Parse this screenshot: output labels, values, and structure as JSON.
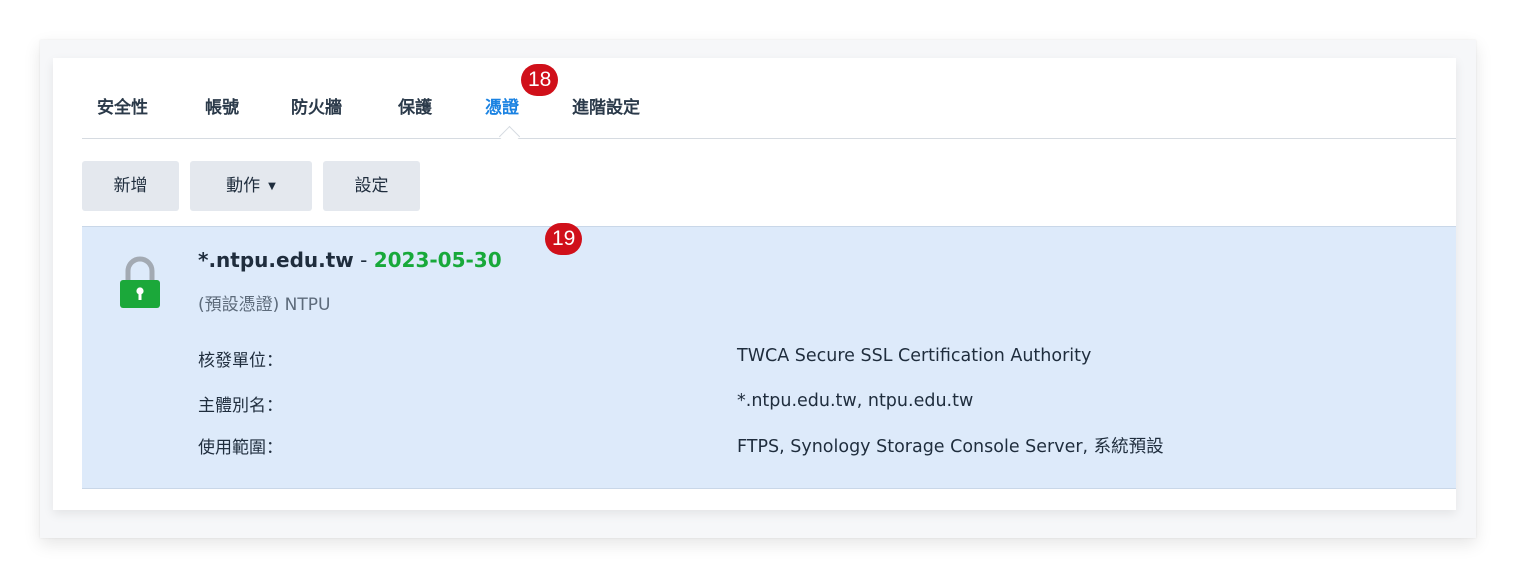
{
  "tabs": [
    {
      "label": "安全性",
      "active": false
    },
    {
      "label": "帳號",
      "active": false
    },
    {
      "label": "防火牆",
      "active": false
    },
    {
      "label": "保護",
      "active": false
    },
    {
      "label": "憑證",
      "active": true
    },
    {
      "label": "進階設定",
      "active": false
    }
  ],
  "badges": {
    "tab": "18",
    "cert": "19",
    "color": "#d0101a"
  },
  "toolbar": {
    "add_label": "新增",
    "action_label": "動作",
    "settings_label": "設定"
  },
  "certificate": {
    "domain": "*.ntpu.edu.tw",
    "separator": "-",
    "expiry_date": "2023-05-30",
    "subtitle": "(預設憑證) NTPU",
    "status_icon": "lock-icon",
    "status_color": "#1ba83a",
    "details": [
      {
        "label": "核發單位：",
        "value": "TWCA Secure SSL Certification Authority"
      },
      {
        "label": "主體別名：",
        "value": "*.ntpu.edu.tw, ntpu.edu.tw"
      },
      {
        "label": "使用範圍：",
        "value": "FTPS, Synology Storage Console Server, 系統預設"
      }
    ]
  },
  "colors": {
    "accent": "#1a82e2",
    "selected_row": "#ddeafa",
    "valid_date": "#18a93a"
  }
}
